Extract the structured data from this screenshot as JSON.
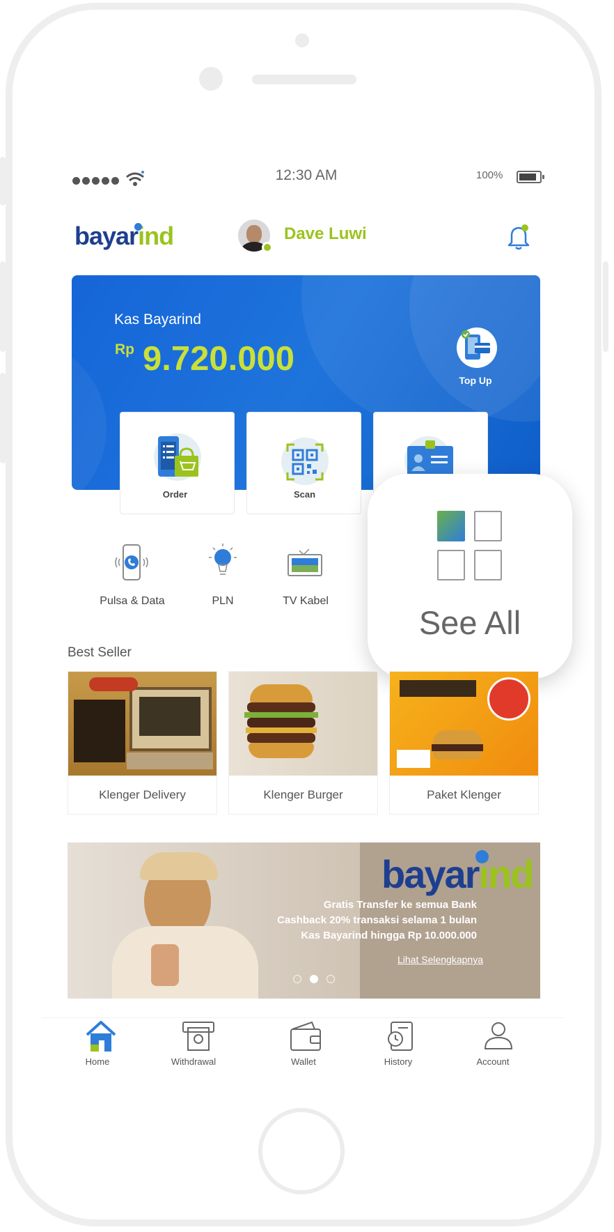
{
  "status_bar": {
    "time": "12:30 AM",
    "battery": "100%"
  },
  "header": {
    "logo_part1": "bayar",
    "logo_part2": "ind",
    "user_name": "Dave Luwi"
  },
  "balance_card": {
    "title": "Kas Bayarind",
    "currency": "Rp",
    "amount": "9.720.000",
    "top_up_label": "Top Up"
  },
  "quick_actions": [
    {
      "label": "Order"
    },
    {
      "label": "Scan"
    }
  ],
  "services": [
    {
      "label": "Pulsa & Data"
    },
    {
      "label": "PLN"
    },
    {
      "label": "TV Kabel"
    }
  ],
  "see_all": {
    "label": "See All"
  },
  "best_seller": {
    "title": "Best Seller",
    "items": [
      {
        "name": "Klenger Delivery"
      },
      {
        "name": "Klenger Burger"
      },
      {
        "name": "Paket Klenger"
      }
    ]
  },
  "banner": {
    "logo_part1": "bayar",
    "logo_part2": "ind",
    "lines": [
      "Gratis Transfer ke semua Bank",
      "Cashback 20% transaksi selama 1 bulan",
      "Kas Bayarind hingga Rp 10.000.000"
    ],
    "link": "Lihat Selengkapnya"
  },
  "bottom_nav": [
    {
      "label": "Home"
    },
    {
      "label": "Withdrawal"
    },
    {
      "label": "Wallet"
    },
    {
      "label": "History"
    },
    {
      "label": "Account"
    }
  ],
  "colors": {
    "brand_blue": "#1565d8",
    "brand_green": "#9bc31e",
    "navy": "#1e3f8f"
  }
}
